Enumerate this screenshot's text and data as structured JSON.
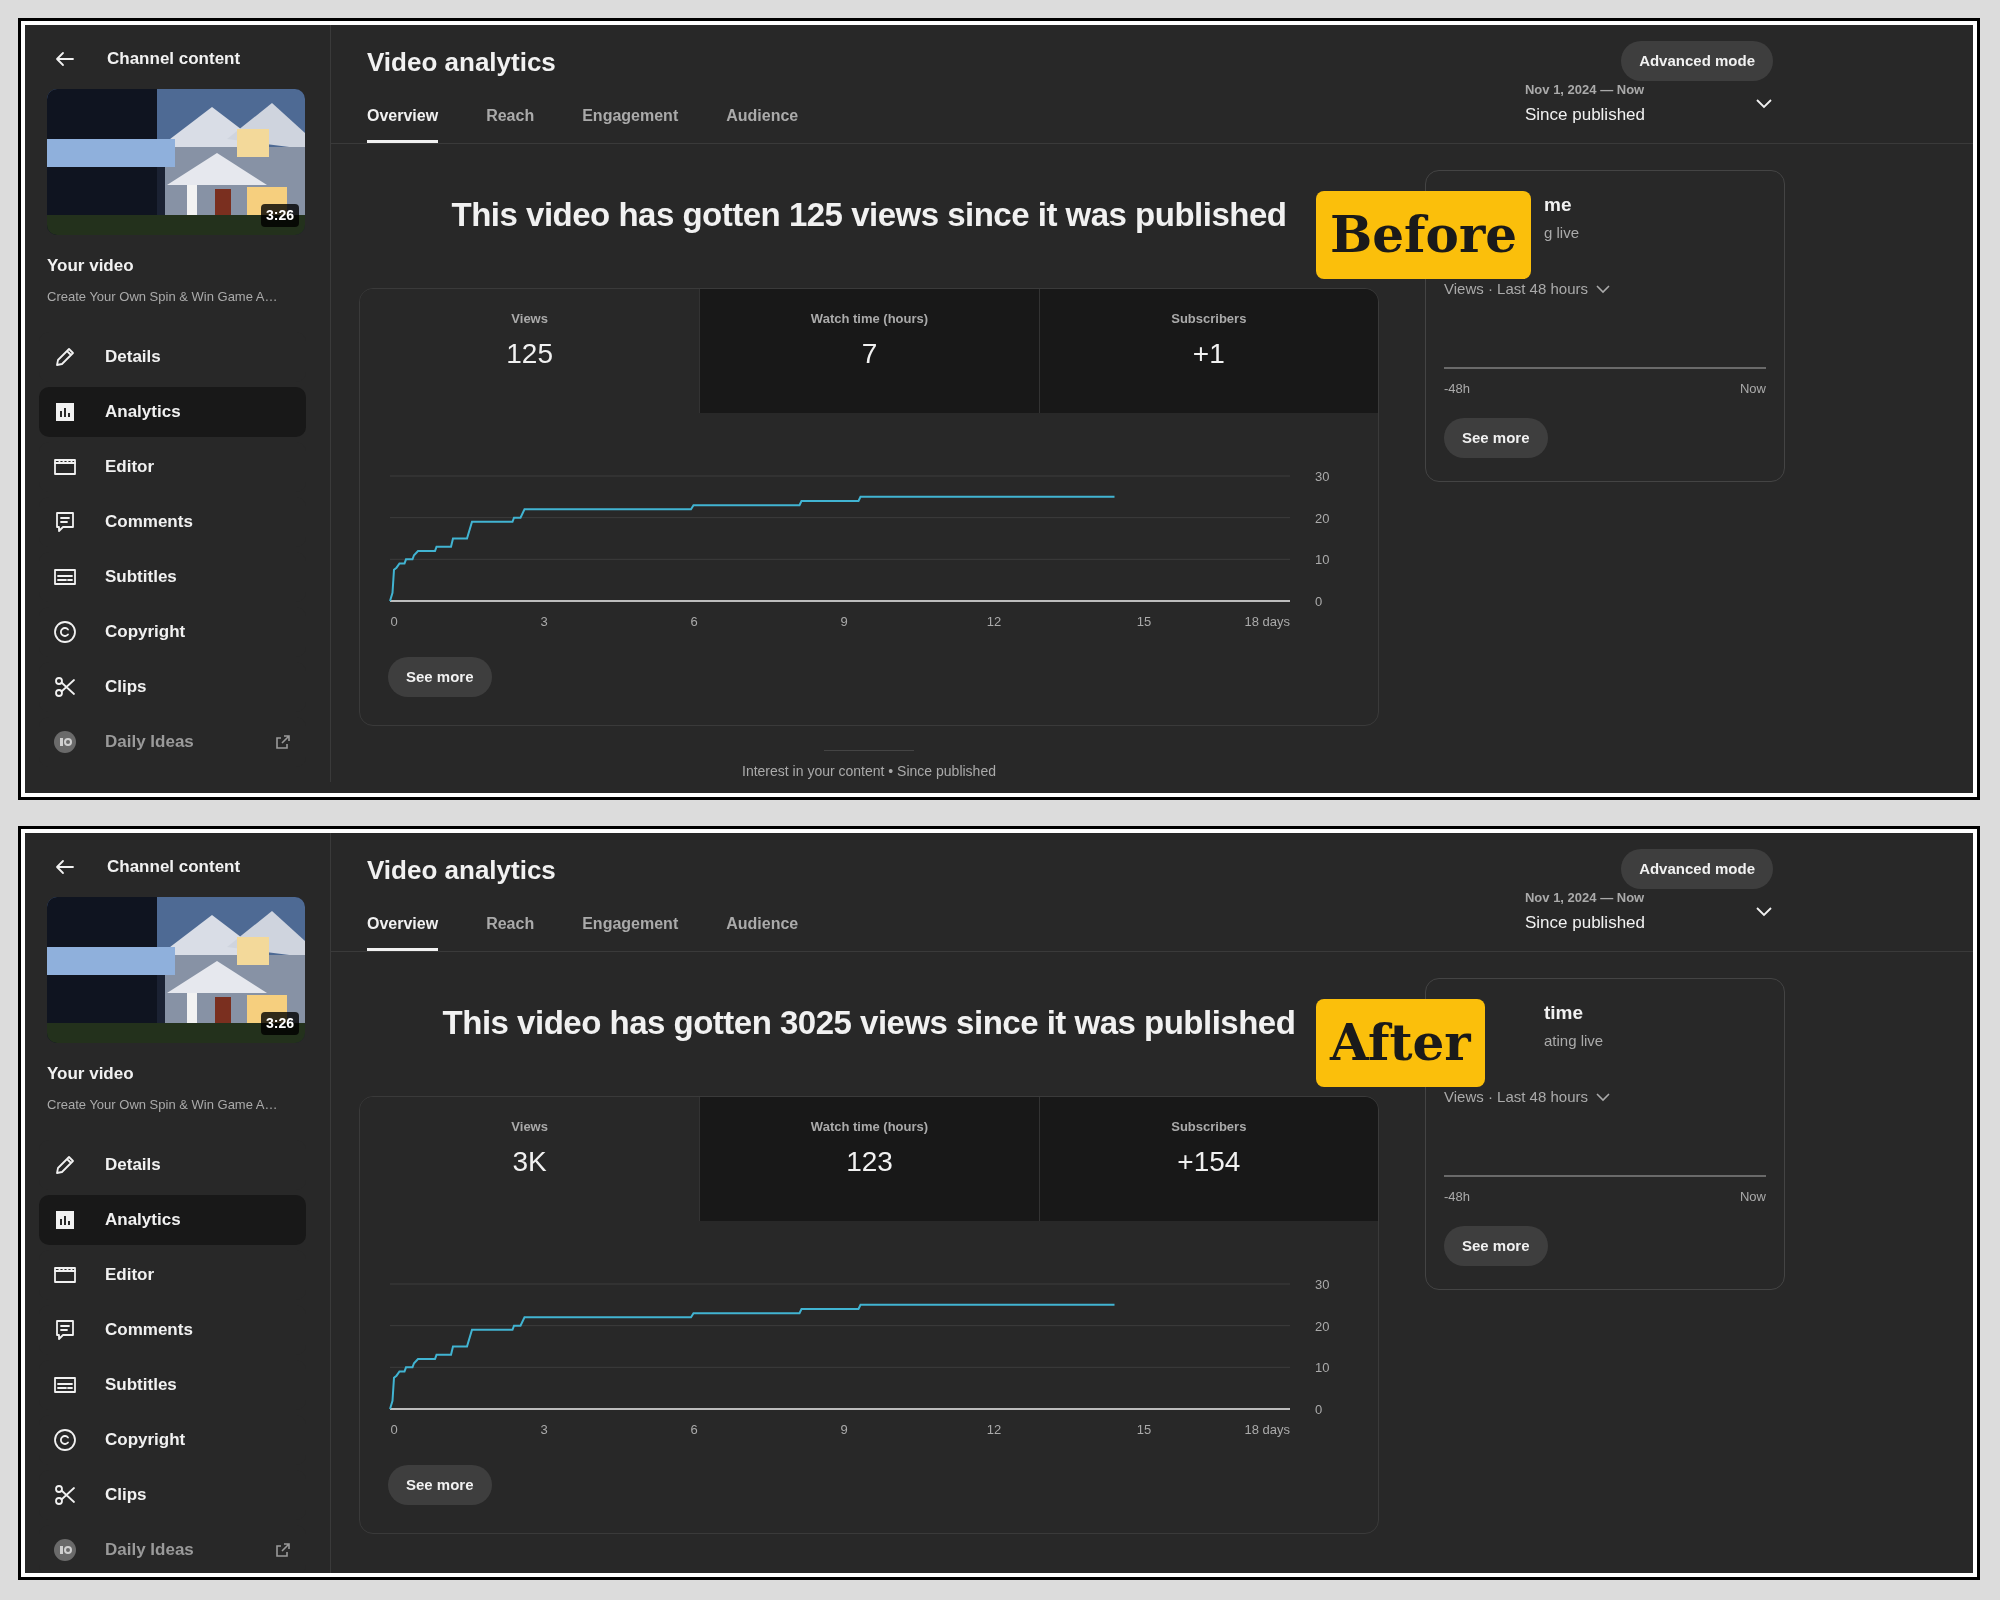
{
  "panels": [
    {
      "badge": "Before",
      "back_label": "Channel content",
      "thumbnail": {
        "kind": "picture",
        "duration": "3:26"
      },
      "your_video": "Your video",
      "video_title": "Create Your Own Spin & Win Game A…",
      "nav": [
        {
          "label": "Details",
          "selected": false,
          "kind": "page"
        },
        {
          "label": "Analytics",
          "selected": true,
          "kind": "page"
        },
        {
          "label": "Editor",
          "selected": false,
          "kind": "page"
        },
        {
          "label": "Comments",
          "selected": false,
          "kind": "page"
        },
        {
          "label": "Subtitles",
          "selected": false,
          "kind": "page"
        },
        {
          "label": "Copyright",
          "selected": false,
          "kind": "page"
        },
        {
          "label": "Clips",
          "selected": false,
          "kind": "page"
        },
        {
          "label": "Daily Ideas",
          "selected": false,
          "kind": "external"
        }
      ],
      "page_title": "Video analytics",
      "advanced_button": "Advanced mode",
      "tabs": [
        {
          "label": "Overview",
          "selected": true
        },
        {
          "label": "Reach",
          "selected": false
        },
        {
          "label": "Engagement",
          "selected": false
        },
        {
          "label": "Audience",
          "selected": false
        }
      ],
      "date_range": {
        "range": "Nov 1, 2024 — Now",
        "label": "Since published"
      },
      "headline": "This video has gotten 125 views since it was published",
      "metrics": [
        {
          "label": "Views",
          "value": "125",
          "selected": true
        },
        {
          "label": "Watch time (hours)",
          "value": "7",
          "selected": false
        },
        {
          "label": "Subscribers",
          "value": "+1",
          "selected": false
        }
      ],
      "chart_data": {
        "type": "line",
        "x": [
          0,
          0.05,
          0.08,
          0.13,
          0.19,
          0.29,
          0.32,
          0.45,
          0.48,
          0.56,
          0.9,
          0.93,
          1.22,
          1.26,
          1.54,
          1.64,
          2.45,
          2.48,
          2.61,
          2.69,
          6.02,
          6.07,
          8.19,
          8.23,
          9.37,
          9.41,
          14.49
        ],
        "series": [
          {
            "color": "#41b4d2",
            "values": [
              0,
              2,
              7.5,
              8,
              9,
              9,
              10,
              10,
              11,
              12,
              12,
              13,
              13,
              15,
              15,
              19,
              19,
              20,
              20,
              22,
              22,
              23,
              23,
              24,
              24,
              25,
              25
            ]
          }
        ],
        "xlim": [
          0,
          18
        ],
        "ylim": [
          0,
          30
        ],
        "xticks": [
          0,
          3,
          6,
          9,
          12,
          15,
          {
            "value": 18,
            "label": "18 days"
          }
        ],
        "yticks": [
          0,
          10,
          20,
          30
        ]
      },
      "see_more": "See more",
      "realtime": {
        "title": "me",
        "subtitle": "g live",
        "metric": "Views · Last 48 hours",
        "start": "-48h",
        "end": "Now",
        "button": "See more"
      },
      "footer": "Interest in your content • Since published"
    },
    {
      "badge": "After",
      "back_label": "Channel content",
      "thumbnail": {
        "kind": "picture",
        "duration": "3:26"
      },
      "your_video": "Your video",
      "video_title": "Create Your Own Spin & Win Game A…",
      "nav": [
        {
          "label": "Details",
          "selected": false,
          "kind": "page"
        },
        {
          "label": "Analytics",
          "selected": true,
          "kind": "page"
        },
        {
          "label": "Editor",
          "selected": false,
          "kind": "page"
        },
        {
          "label": "Comments",
          "selected": false,
          "kind": "page"
        },
        {
          "label": "Subtitles",
          "selected": false,
          "kind": "page"
        },
        {
          "label": "Copyright",
          "selected": false,
          "kind": "page"
        },
        {
          "label": "Clips",
          "selected": false,
          "kind": "page"
        },
        {
          "label": "Daily Ideas",
          "selected": false,
          "kind": "external"
        }
      ],
      "page_title": "Video analytics",
      "advanced_button": "Advanced mode",
      "tabs": [
        {
          "label": "Overview",
          "selected": true
        },
        {
          "label": "Reach",
          "selected": false
        },
        {
          "label": "Engagement",
          "selected": false
        },
        {
          "label": "Audience",
          "selected": false
        }
      ],
      "date_range": {
        "range": "Nov 1, 2024 — Now",
        "label": "Since published"
      },
      "headline": "This video has gotten 3025 views since it was published",
      "metrics": [
        {
          "label": "Views",
          "value": "3K",
          "selected": true
        },
        {
          "label": "Watch time (hours)",
          "value": "123",
          "selected": false
        },
        {
          "label": "Subscribers",
          "value": "+154",
          "selected": false
        }
      ],
      "chart_data": {
        "type": "line",
        "x": [
          0,
          0.05,
          0.08,
          0.13,
          0.19,
          0.29,
          0.32,
          0.45,
          0.48,
          0.56,
          0.9,
          0.93,
          1.22,
          1.26,
          1.54,
          1.64,
          2.45,
          2.48,
          2.61,
          2.69,
          6.02,
          6.07,
          8.19,
          8.23,
          9.37,
          9.41,
          14.49
        ],
        "series": [
          {
            "color": "#41b4d2",
            "values": [
              0,
              2,
              7.5,
              8,
              9,
              9,
              10,
              10,
              11,
              12,
              12,
              13,
              13,
              15,
              15,
              19,
              19,
              20,
              20,
              22,
              22,
              23,
              23,
              24,
              24,
              25,
              25
            ]
          }
        ],
        "xlim": [
          0,
          18
        ],
        "ylim": [
          0,
          30
        ],
        "xticks": [
          0,
          3,
          6,
          9,
          12,
          15,
          {
            "value": 18,
            "label": "18 days"
          }
        ],
        "yticks": [
          0,
          10,
          20,
          30
        ]
      },
      "see_more": "See more",
      "realtime": {
        "title": "time",
        "subtitle": "ating live",
        "metric": "Views · Last 48 hours",
        "start": "-48h",
        "end": "Now",
        "button": "See more"
      }
    }
  ]
}
